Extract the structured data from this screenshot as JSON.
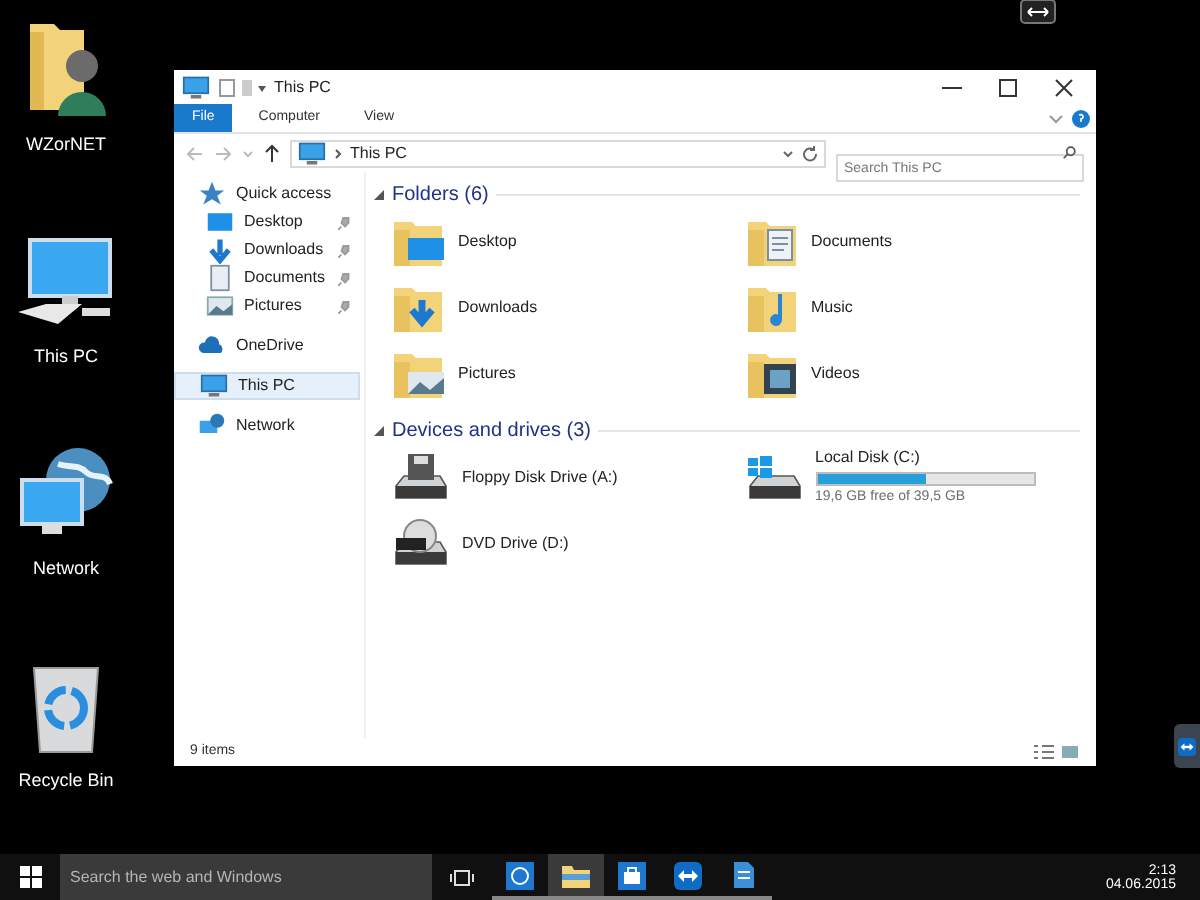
{
  "desktop_icons": [
    {
      "label": "WZorNET",
      "kind": "user-folder"
    },
    {
      "label": "This PC",
      "kind": "computer"
    },
    {
      "label": "Network",
      "kind": "network"
    },
    {
      "label": "Recycle Bin",
      "kind": "recycle-bin"
    }
  ],
  "explorer": {
    "title": "This PC",
    "ribbon_tabs": [
      {
        "label": "File",
        "selected": true
      },
      {
        "label": "Computer",
        "selected": false
      },
      {
        "label": "View",
        "selected": false
      }
    ],
    "address": "This PC",
    "search": {
      "placeholder": "Search This PC"
    },
    "nav": [
      {
        "label": "Quick access",
        "kind": "star",
        "selected": false,
        "children": [
          {
            "label": "Desktop",
            "kind": "desktop",
            "pinned": true,
            "selected": false
          },
          {
            "label": "Downloads",
            "kind": "download",
            "pinned": true,
            "selected": false
          },
          {
            "label": "Documents",
            "kind": "document",
            "pinned": true,
            "selected": false
          },
          {
            "label": "Pictures",
            "kind": "picture",
            "pinned": true,
            "selected": false
          }
        ]
      },
      {
        "label": "OneDrive",
        "kind": "cloud",
        "selected": false
      },
      {
        "label": "This PC",
        "kind": "computer",
        "selected": true
      },
      {
        "label": "Network",
        "kind": "network",
        "selected": false
      }
    ],
    "sections": [
      {
        "title": "Folders (6)",
        "expanded": true,
        "items": [
          {
            "label": "Desktop",
            "kind": "desktop"
          },
          {
            "label": "Documents",
            "kind": "document"
          },
          {
            "label": "Downloads",
            "kind": "download"
          },
          {
            "label": "Music",
            "kind": "music"
          },
          {
            "label": "Pictures",
            "kind": "picture"
          },
          {
            "label": "Videos",
            "kind": "video"
          }
        ]
      },
      {
        "title": "Devices and drives (3)",
        "expanded": true,
        "items": [
          {
            "label": "Floppy Disk Drive (A:)",
            "kind": "floppy"
          },
          {
            "label": "Local Disk (C:)",
            "kind": "disk",
            "level": 0.5,
            "reading": "19,6 GB free of 39,5 GB"
          },
          {
            "label": "DVD Drive (D:)",
            "kind": "dvd"
          }
        ]
      }
    ],
    "status": "9 items"
  },
  "taskbar": {
    "search": {
      "placeholder": "Search the web and Windows"
    },
    "apps": [
      {
        "kind": "edge",
        "active": false
      },
      {
        "kind": "explorer",
        "active": true
      },
      {
        "kind": "store",
        "active": false
      },
      {
        "kind": "teamviewer",
        "active": false
      },
      {
        "kind": "document",
        "active": false
      }
    ],
    "time": "2:13",
    "date": "04.06.2015"
  }
}
